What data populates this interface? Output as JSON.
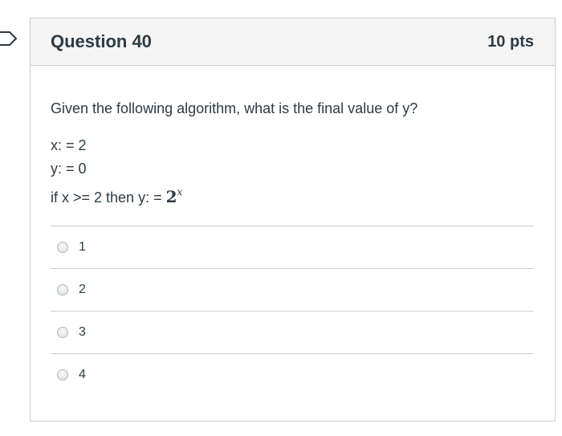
{
  "question": {
    "title": "Question 40",
    "points": "10 pts",
    "prompt": "Given the following algorithm, what is the final value of y?",
    "code_lines": [
      "x: = 2",
      "y: = 0",
      "if x >= 2 then y: = "
    ],
    "math_base": "2",
    "math_exponent": "x"
  },
  "answers": [
    {
      "label": "1"
    },
    {
      "label": "2"
    },
    {
      "label": "3"
    },
    {
      "label": "4"
    }
  ],
  "icons": {
    "flag": "flag-icon",
    "radio": "radio-button"
  },
  "colors": {
    "text": "#2d3b45",
    "border": "#c7cdd1",
    "header_bg": "#f5f5f5",
    "flag_stroke": "#2d3b45"
  }
}
